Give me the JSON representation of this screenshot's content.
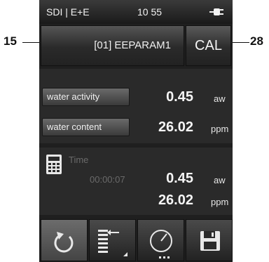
{
  "callouts": {
    "left": "15",
    "right": "28"
  },
  "status_bar": {
    "left_text": "SDI | E+E",
    "time": "10 55"
  },
  "device_button": {
    "label": "[01] EEPARAM1"
  },
  "cal_button": {
    "label": "CAL"
  },
  "parameters": [
    {
      "label": "water activity",
      "value": "0.45",
      "unit": "aw"
    },
    {
      "label": "water content",
      "value": "26.02",
      "unit": "ppm"
    }
  ],
  "timer": {
    "label": "Time",
    "elapsed": "00:00:07",
    "values": [
      {
        "value": "0.45",
        "unit": "aw"
      },
      {
        "value": "26.02",
        "unit": "ppm"
      }
    ]
  },
  "toolbar": {
    "icons": [
      "refresh-icon",
      "list-settings-icon",
      "gauge-menu-icon",
      "save-icon"
    ]
  }
}
